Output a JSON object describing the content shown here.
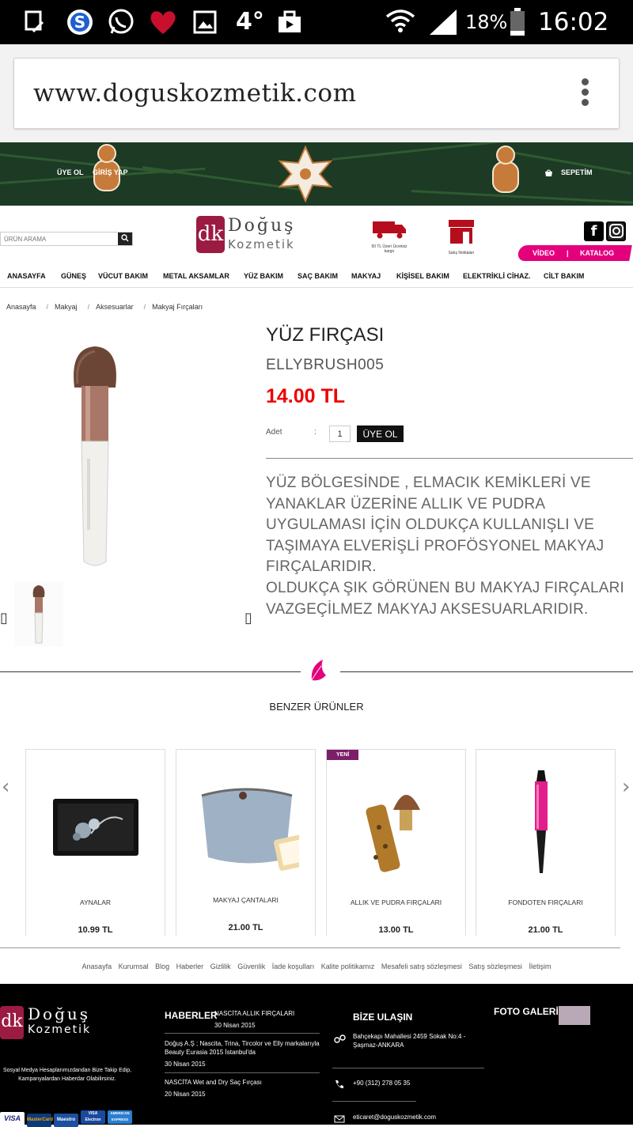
{
  "status_bar": {
    "icons": [
      "notification-icon",
      "skype-icon",
      "whatsapp-icon",
      "heart-icon",
      "image-icon",
      "weather-icon",
      "share-icon",
      "wifi-icon",
      "signal-icon",
      "battery-icon"
    ],
    "temperature": "4°",
    "battery": "18%",
    "time": "16:02"
  },
  "browser": {
    "url": "www.doguskozmetik.com"
  },
  "top_banner": {
    "signup": "ÜYE OL",
    "login": "GİRİŞ YAP",
    "cart": "SEPETİM"
  },
  "header": {
    "search_placeholder": "ÜRÜN ARAMA",
    "logo_line1": "Doğuş",
    "logo_line2": "Kozmetik",
    "logo_mark": "dk",
    "shipping_text": "50 TL Üzeri Ücretsiz kargo",
    "store_text": "Satış Noktaları",
    "video": "VİDEO",
    "catalog": "KATALOG"
  },
  "nav": [
    "ANASAYFA",
    "GÜNEŞ",
    "VÜCUT BAKIM",
    "METAL AKSAMLAR",
    "YÜZ BAKIM",
    "SAÇ BAKIM",
    "MAKYAJ",
    "KİŞİSEL BAKIM",
    "ELEKTRİKLİ CİHAZ.",
    "CİLT BAKIM"
  ],
  "breadcrumb": [
    "Anasayfa",
    "Makyaj",
    "Aksesuarlar",
    "Makyaj Fırçaları"
  ],
  "product": {
    "title": "YÜZ FIRÇASI",
    "code": "ELLYBRUSH005",
    "price": "14.00 TL",
    "qty_label": "Adet",
    "qty_value": "1",
    "button": "ÜYE OL",
    "description": "YÜZ BÖLGESİNDE , ELMACIK KEMİKLERİ VE YANAKLAR ÜZERİNE ALLIK VE PUDRA UYGULAMASI İÇİN OLDUKÇA KULLANIŞLI VE TAŞIMAYA ELVERİŞLİ PROFÖSYONEL MAKYAJ FIRÇALARIDIR.\nOLDUKÇA ŞIK GÖRÜNEN BU MAKYAJ FIRÇALARI VAZGEÇİLMEZ MAKYAJ AKSESUARLARIDIR."
  },
  "similar": {
    "heading": "BENZER ÜRÜNLER",
    "items": [
      {
        "name": "AYNALAR",
        "price": "10.99 TL",
        "badge": ""
      },
      {
        "name": "MAKYAJ ÇANTALARI",
        "price": "21.00 TL",
        "badge": ""
      },
      {
        "name": "ALLIK VE PUDRA FIRÇALARI",
        "price": "13.00 TL",
        "badge": "YENİ"
      },
      {
        "name": "FONDOTEN FIRÇALARI",
        "price": "21.00 TL",
        "badge": ""
      }
    ]
  },
  "footer_links": [
    "Anasayfa",
    "Kurumsal",
    "Blog",
    "Haberler",
    "Gizlilik",
    "Güvenlik",
    "İade koşulları",
    "Kalite politikamız",
    "Mesafeli satış sözleşmesi",
    "Satış sözleşmesi",
    "İletişim"
  ],
  "footer": {
    "social_text": "Sosyal Medya Hesaplarımızdandan Bize Takip Edip, Kampanyalardan Haberdar Olabilirsiniz.",
    "payment_cards": [
      "VISA",
      "MasterCard",
      "Maestro",
      "VISA Electron",
      "AMERICAN EXPRESS"
    ],
    "news_heading": "HABERLER",
    "news": [
      {
        "title": "NASCİTA ALLIK FIRÇALARI",
        "date": "30 Nisan 2015"
      },
      {
        "title": "Doğuş A.Ş ; Nascita, Trina, Tircolor ve Elly markalarıyla Beauty Eurasia 2015 İstanbul'da",
        "date": "30 Nisan 2015"
      },
      {
        "title": "NASCİTA Wet and Dry Saç Fırçası",
        "date": "20 Nisan 2015"
      }
    ],
    "contact_heading": "BİZE ULAŞIN",
    "address": "Bahçekapı Mahallesi 2459 Sokak No:4 - Şaşmaz-ANKARA",
    "phone": "+90 (312) 278 05 35",
    "email": "eticaret@doguskozmetik.com",
    "gallery_heading": "FOTO GALERİ"
  },
  "colors": {
    "accent_pink": "#e4007d",
    "brand_burgundy": "#9b1b43",
    "price_red": "#e00000",
    "badge_purple": "#7b1f6a"
  }
}
